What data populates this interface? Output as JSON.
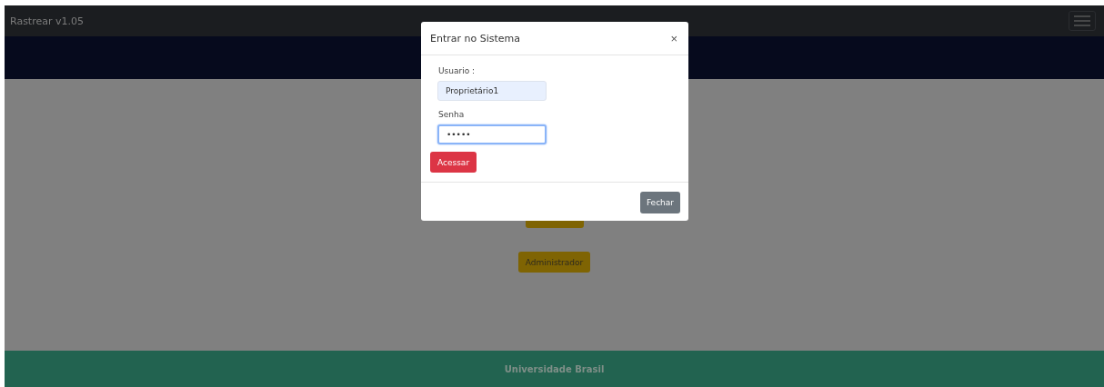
{
  "navbar": {
    "brand": "Rastrear v1.05"
  },
  "content": {
    "buttons": [
      "Administrador"
    ]
  },
  "footer": {
    "text": "Universidade Brasil"
  },
  "modal": {
    "title": "Entrar no Sistema",
    "close": "×",
    "fields": [
      {
        "label": "Usuario :",
        "value": "Proprietário1",
        "autofilled": true,
        "focused": false
      },
      {
        "label": "Senha",
        "value": "•••••",
        "autofilled": false,
        "focused": true
      }
    ],
    "submit": "Acessar",
    "dismiss": "Fechar"
  }
}
